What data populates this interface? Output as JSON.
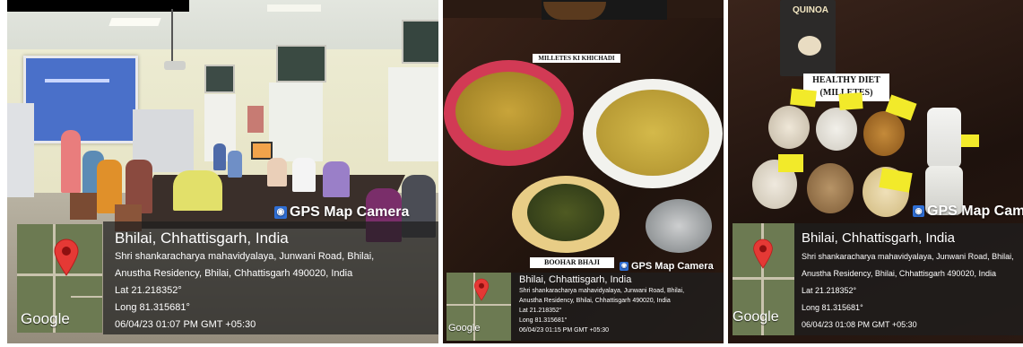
{
  "panel1": {
    "camera_label": "GPS Map Camera",
    "title": "Bhilai, Chhattisgarh, India",
    "address_line1": "Shri shankaracharya mahavidyalaya, Junwani Road, Bhilai,",
    "address_line2": "Anustha Residency, Bhilai, Chhattisgarh 490020, India",
    "lat": "Lat 21.218352°",
    "long": "Long 81.315681°",
    "datetime": "06/04/23 01:07 PM GMT +05:30",
    "google": "Google"
  },
  "panel2": {
    "top_sign": "MILLETES KI KHICHADI",
    "bottom_sign": "BOOHAR BHAJI",
    "camera_label": "GPS Map Camera",
    "title": "Bhilai, Chhattisgarh, India",
    "address_line1": "Shri shankaracharya mahavidyalaya, Junwani Road, Bhilai,",
    "address_line2": "Anustha Residency, Bhilai, Chhattisgarh 490020, India",
    "lat": "Lat 21.218352°",
    "long": "Long 81.315681°",
    "datetime": "06/04/23 01:15 PM GMT +05:30",
    "google": "Google"
  },
  "panel3": {
    "pack_label": "QUINOA",
    "sign_line1": "HEALTHY DIET",
    "sign_line2": "(MILLETES)",
    "camera_label": "GPS Map Camera",
    "title": "Bhilai, Chhattisgarh, India",
    "address_line1": "Shri shankaracharya mahavidyalaya, Junwani Road, Bhilai,",
    "address_line2": "Anustha Residency, Bhilai, Chhattisgarh 490020, India",
    "lat": "Lat 21.218352°",
    "long": "Long 81.315681°",
    "datetime": "06/04/23 01:08 PM GMT +05:30",
    "google": "Google"
  },
  "colors": {
    "overlay": "#1e1e1e",
    "pin": "#e53935",
    "badge": "#2f6fd6"
  },
  "icons": {
    "pin": "map-pin-icon",
    "camera": "gps-camera-icon"
  }
}
